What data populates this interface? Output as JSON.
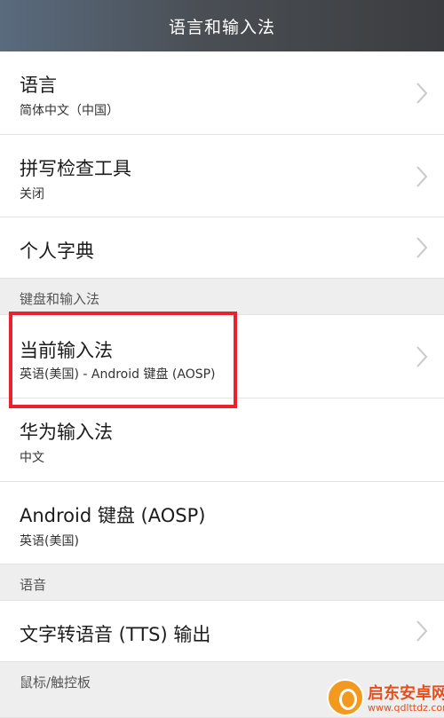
{
  "header": {
    "title": "语言和输入法"
  },
  "rows": [
    {
      "title": "语言",
      "subtitle": "简体中文（中国）"
    },
    {
      "title": "拼写检查工具",
      "subtitle": "关闭"
    },
    {
      "title": "个人字典"
    }
  ],
  "section_keyboard": {
    "label": "键盘和输入法"
  },
  "keyboard_rows": [
    {
      "title": "当前输入法",
      "subtitle": "英语(美国) - Android 键盘 (AOSP)"
    },
    {
      "title": "华为输入法",
      "subtitle": "中文"
    },
    {
      "title": "Android 键盘 (AOSP)",
      "subtitle": "英语(美国)"
    }
  ],
  "section_speech": {
    "label": "语音"
  },
  "speech_rows": [
    {
      "title": "文字转语音 (TTS) 输出"
    }
  ],
  "section_mouse": {
    "label": "鼠标/触控板"
  },
  "watermark": {
    "name": "启东安卓网",
    "url": "www.qdlttdz.com"
  },
  "colors": {
    "highlight": "#e8232e",
    "accent": "#f39a1e"
  }
}
